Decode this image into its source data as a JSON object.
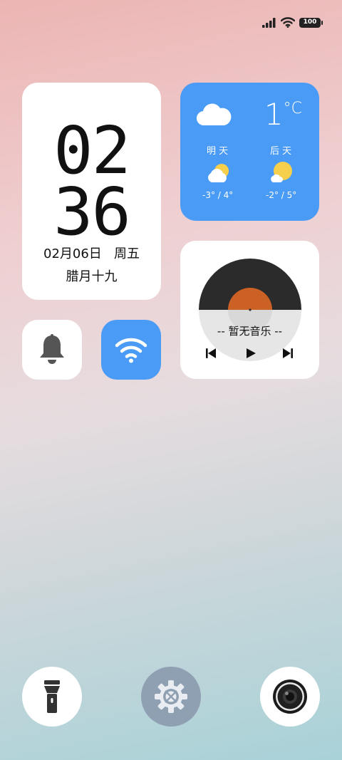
{
  "status_bar": {
    "battery_level": "100",
    "icons": [
      "signal-icon",
      "wifi-icon",
      "battery-icon"
    ]
  },
  "clock_widget": {
    "hour": "02",
    "minute": "36",
    "date": "02月06日",
    "weekday": "周五",
    "lunar": "腊月十九"
  },
  "weather_widget": {
    "current_temp": "1",
    "unit": "°C",
    "current_icon": "cloud-icon",
    "tomorrow": {
      "label": "明 天",
      "temp": "-3° / 4°",
      "icon": "partly-cloudy-icon"
    },
    "day_after": {
      "label": "后 天",
      "temp": "-2° / 5°",
      "icon": "partly-cloudy-icon"
    },
    "background_color": "#4a9bf5"
  },
  "music_widget": {
    "title": "-- 暂无音乐 --",
    "controls": [
      "previous",
      "play",
      "next"
    ]
  },
  "quick_toggles": [
    {
      "name": "bell",
      "icon": "bell-icon"
    },
    {
      "name": "wifi",
      "icon": "wifi-icon",
      "active": true,
      "color": "#4a9bf5"
    }
  ],
  "dock": [
    {
      "name": "flashlight",
      "icon": "flashlight-icon"
    },
    {
      "name": "settings",
      "icon": "settings-icon"
    },
    {
      "name": "camera",
      "icon": "camera-icon"
    }
  ]
}
